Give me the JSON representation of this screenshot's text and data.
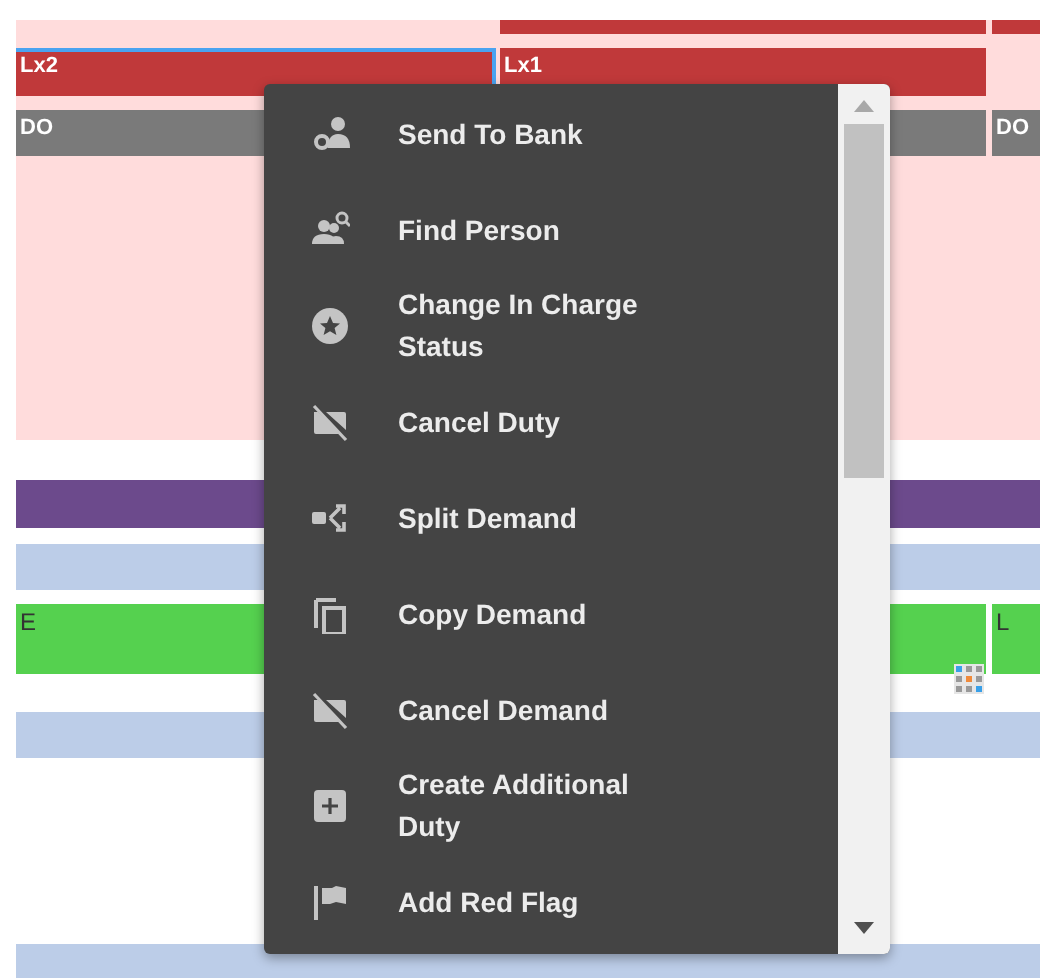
{
  "timeline": {
    "lanes": [
      {
        "bars": [
          {
            "color": "#c0393a",
            "selected": false
          },
          {
            "color": "#c0393a",
            "selected": false
          }
        ]
      },
      {
        "bars": [
          {
            "label": "Lx2",
            "color": "#c0393a",
            "selected": true
          },
          {
            "label": "Lx1",
            "color": "#c0393a",
            "selected": false
          }
        ]
      },
      {
        "bars": [
          {
            "label": "DO",
            "color": "#7a7a7a",
            "selected": false
          },
          {
            "label": "DO",
            "color": "#7a7a7a",
            "selected": false
          }
        ]
      },
      {
        "bars": [
          {
            "color": "#6c4a8c",
            "selected": false
          }
        ]
      },
      {
        "bars": [
          {
            "color": "#bccde8",
            "selected": false
          }
        ]
      },
      {
        "bars": [
          {
            "label": "E",
            "color": "#55d14f",
            "selected": false
          },
          {
            "label": "L",
            "color": "#55d14f",
            "selected": false
          }
        ]
      },
      {
        "bars": [
          {
            "color": "#bccde8",
            "selected": false
          }
        ]
      },
      {
        "bars": [
          {
            "color": "#bccde8",
            "selected": false
          }
        ]
      }
    ]
  },
  "context_menu": {
    "items": [
      {
        "label": "Send To Bank"
      },
      {
        "label": "Find Person"
      },
      {
        "label": "Change In Charge Status"
      },
      {
        "label": "Cancel Duty"
      },
      {
        "label": "Split Demand"
      },
      {
        "label": "Copy Demand"
      },
      {
        "label": "Cancel Demand"
      },
      {
        "label": "Create Additional Duty"
      },
      {
        "label": "Add Red Flag"
      }
    ]
  }
}
